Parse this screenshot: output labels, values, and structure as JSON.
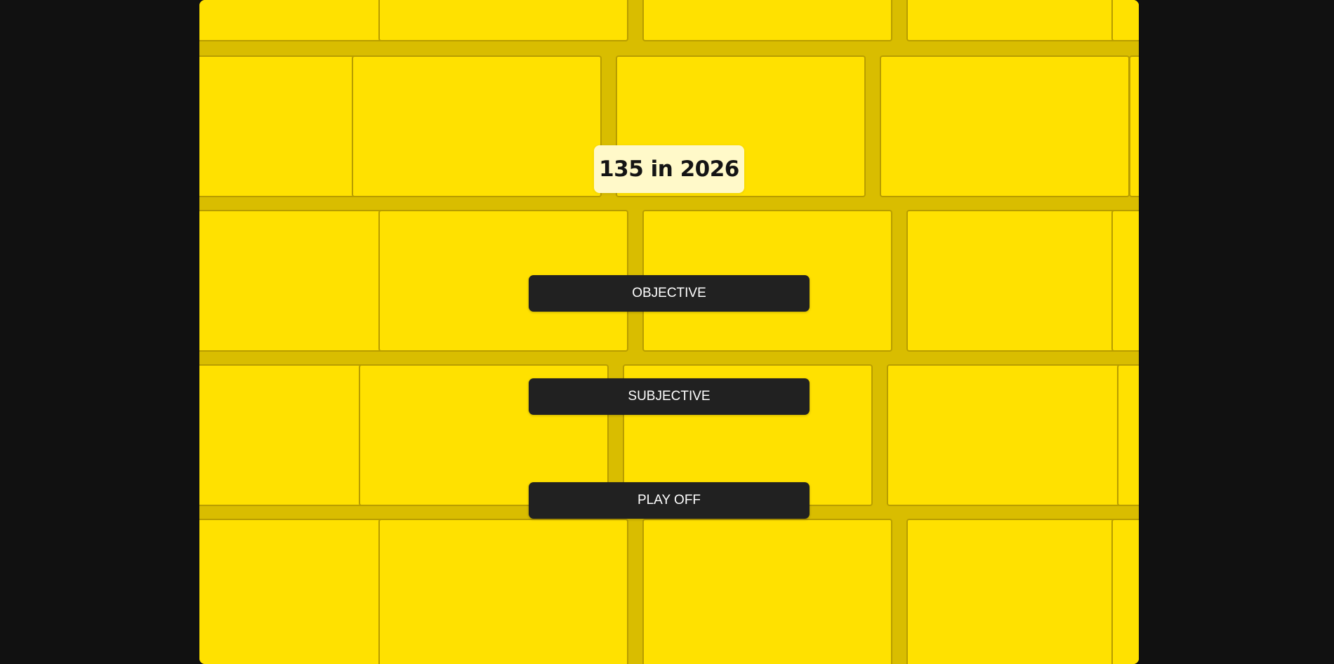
{
  "game": {
    "title": "135 in 2026"
  },
  "menu": {
    "buttons": [
      {
        "label": "OBJECTIVE"
      },
      {
        "label": "SUBJECTIVE"
      },
      {
        "label": "PLAY OFF"
      }
    ]
  },
  "colors": {
    "page_background": "#111111",
    "wall_brick": "#ffe100",
    "wall_mortar": "#d9bd00",
    "title_box": "#fff9c9",
    "button_background": "#212121",
    "button_text": "#ffffff"
  }
}
